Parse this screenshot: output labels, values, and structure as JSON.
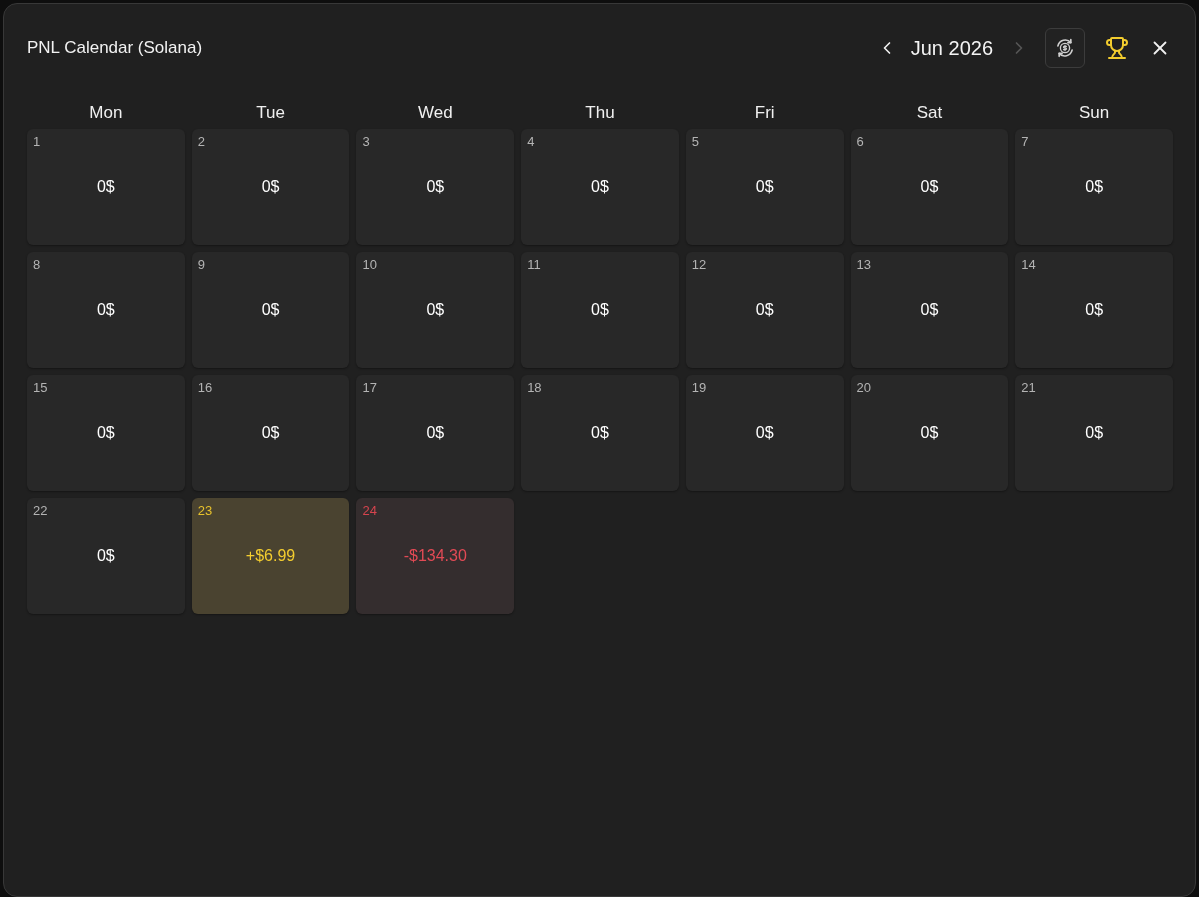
{
  "window": {
    "title": "PNL Calendar (Solana)"
  },
  "navigation": {
    "month": "Jun 2026",
    "prev_disabled": false,
    "next_disabled": true
  },
  "weekdays": [
    "Mon",
    "Tue",
    "Wed",
    "Thu",
    "Fri",
    "Sat",
    "Sun"
  ],
  "days": [
    {
      "day": "1",
      "value": "0$",
      "kind": "flat"
    },
    {
      "day": "2",
      "value": "0$",
      "kind": "flat"
    },
    {
      "day": "3",
      "value": "0$",
      "kind": "flat"
    },
    {
      "day": "4",
      "value": "0$",
      "kind": "flat"
    },
    {
      "day": "5",
      "value": "0$",
      "kind": "flat"
    },
    {
      "day": "6",
      "value": "0$",
      "kind": "flat"
    },
    {
      "day": "7",
      "value": "0$",
      "kind": "flat"
    },
    {
      "day": "8",
      "value": "0$",
      "kind": "flat"
    },
    {
      "day": "9",
      "value": "0$",
      "kind": "flat"
    },
    {
      "day": "10",
      "value": "0$",
      "kind": "flat"
    },
    {
      "day": "11",
      "value": "0$",
      "kind": "flat"
    },
    {
      "day": "12",
      "value": "0$",
      "kind": "flat"
    },
    {
      "day": "13",
      "value": "0$",
      "kind": "flat"
    },
    {
      "day": "14",
      "value": "0$",
      "kind": "flat"
    },
    {
      "day": "15",
      "value": "0$",
      "kind": "flat"
    },
    {
      "day": "16",
      "value": "0$",
      "kind": "flat"
    },
    {
      "day": "17",
      "value": "0$",
      "kind": "flat"
    },
    {
      "day": "18",
      "value": "0$",
      "kind": "flat"
    },
    {
      "day": "19",
      "value": "0$",
      "kind": "flat"
    },
    {
      "day": "20",
      "value": "0$",
      "kind": "flat"
    },
    {
      "day": "21",
      "value": "0$",
      "kind": "flat"
    },
    {
      "day": "22",
      "value": "0$",
      "kind": "flat"
    },
    {
      "day": "23",
      "value": "+$6.99",
      "kind": "gain"
    },
    {
      "day": "24",
      "value": "-$134.30",
      "kind": "loss"
    }
  ]
}
